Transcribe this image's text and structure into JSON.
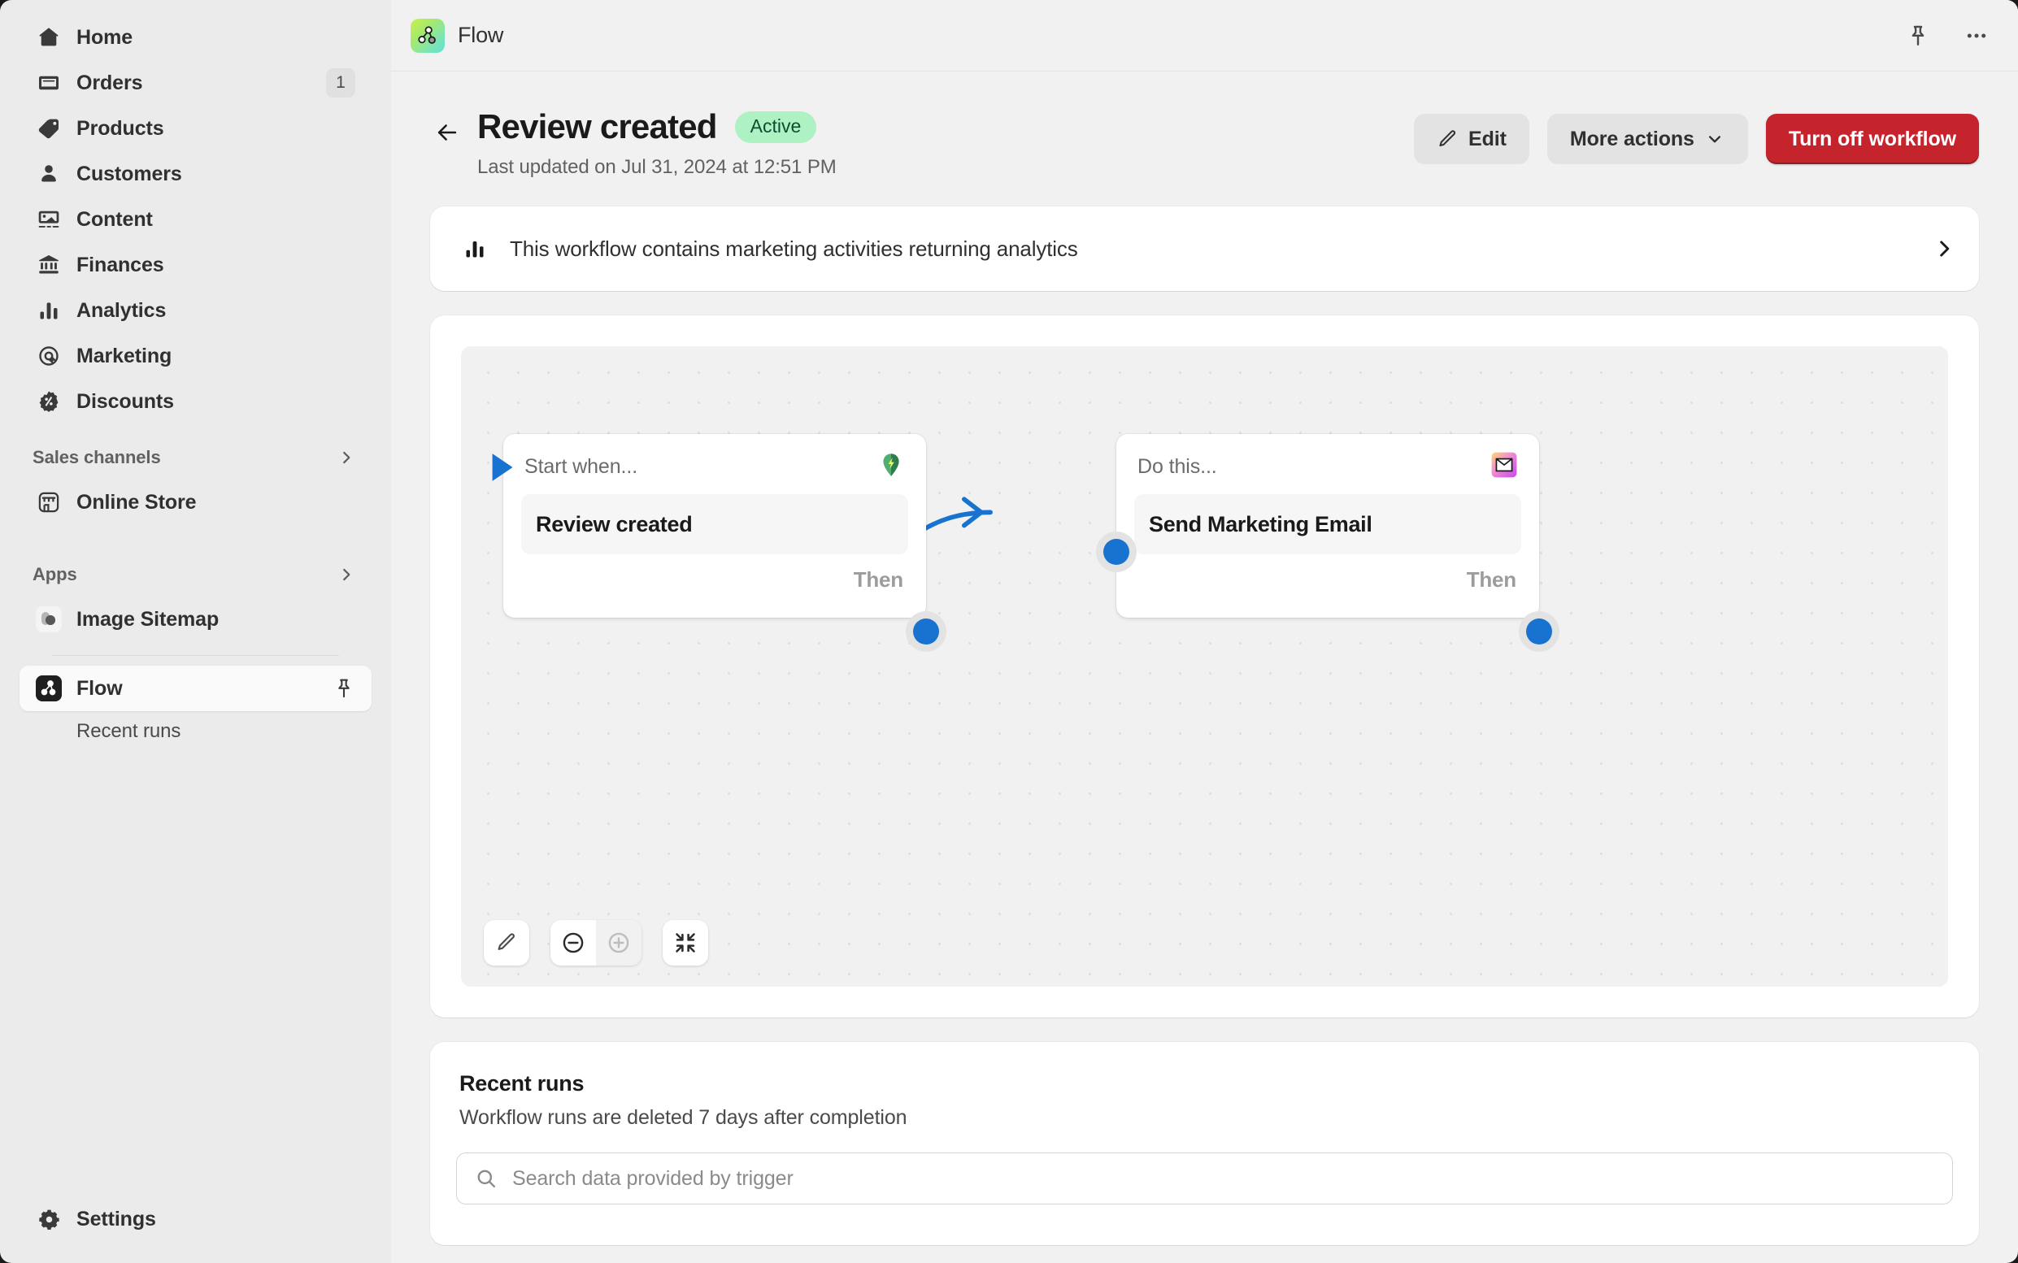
{
  "sidebar": {
    "items": [
      {
        "label": "Home",
        "icon": "home-icon",
        "badge": null
      },
      {
        "label": "Orders",
        "icon": "orders-icon",
        "badge": "1"
      },
      {
        "label": "Products",
        "icon": "products-icon",
        "badge": null
      },
      {
        "label": "Customers",
        "icon": "customers-icon",
        "badge": null
      },
      {
        "label": "Content",
        "icon": "content-icon",
        "badge": null
      },
      {
        "label": "Finances",
        "icon": "finances-icon",
        "badge": null
      },
      {
        "label": "Analytics",
        "icon": "analytics-icon",
        "badge": null
      },
      {
        "label": "Marketing",
        "icon": "marketing-icon",
        "badge": null
      },
      {
        "label": "Discounts",
        "icon": "discounts-icon",
        "badge": null
      }
    ],
    "sales_channels": {
      "title": "Sales channels",
      "items": [
        {
          "label": "Online Store",
          "icon": "storefront-icon"
        }
      ]
    },
    "apps": {
      "title": "Apps",
      "items": [
        {
          "label": "Image Sitemap",
          "icon": "image-sitemap-app-icon"
        },
        {
          "label": "Flow",
          "icon": "flow-app-icon",
          "pinned": true
        }
      ],
      "sub_items": [
        {
          "label": "Recent runs"
        }
      ]
    },
    "footer": {
      "label": "Settings",
      "icon": "gear-icon"
    }
  },
  "topbar": {
    "app_icon": "flow-app-icon",
    "title": "Flow",
    "pin_icon": "pin-icon",
    "more_icon": "ellipsis-icon"
  },
  "page_header": {
    "back_icon": "arrow-left-icon",
    "title": "Review created",
    "status": "Active",
    "subtitle": "Last updated on Jul 31, 2024 at 12:51 PM",
    "actions": {
      "edit_label": "Edit",
      "edit_icon": "pencil-icon",
      "more_actions_label": "More actions",
      "more_actions_icon": "chevron-down-icon",
      "turn_off_label": "Turn off workflow"
    }
  },
  "banner": {
    "icon": "bar-chart-icon",
    "text": "This workflow contains marketing activities returning analytics",
    "chevron_icon": "chevron-right-icon"
  },
  "flow": {
    "nodes": [
      {
        "head_label": "Start when...",
        "head_icon": "trigger-bolt-icon",
        "body_text": "Review created",
        "foot_label": "Then"
      },
      {
        "head_label": "Do this...",
        "head_icon": "marketing-email-icon",
        "body_text": "Send Marketing Email",
        "foot_label": "Then"
      }
    ],
    "tools": {
      "edit_icon": "pencil-icon",
      "zoom_out_icon": "minus-circle-icon",
      "zoom_in_icon": "plus-circle-icon",
      "fit_icon": "collapse-icon"
    },
    "accent_color": "#1773CF"
  },
  "recent_runs": {
    "title": "Recent runs",
    "subtitle": "Workflow runs are deleted 7 days after completion",
    "search": {
      "icon": "search-icon",
      "placeholder": "Search data provided by trigger",
      "value": ""
    }
  },
  "colors": {
    "sidebar_bg": "#EBEBEB",
    "main_bg": "#F1F1F1",
    "critical": "#C6242C",
    "status_bg": "#AEF2C4",
    "status_text": "#0B4E30",
    "accent_blue": "#1773CF"
  }
}
